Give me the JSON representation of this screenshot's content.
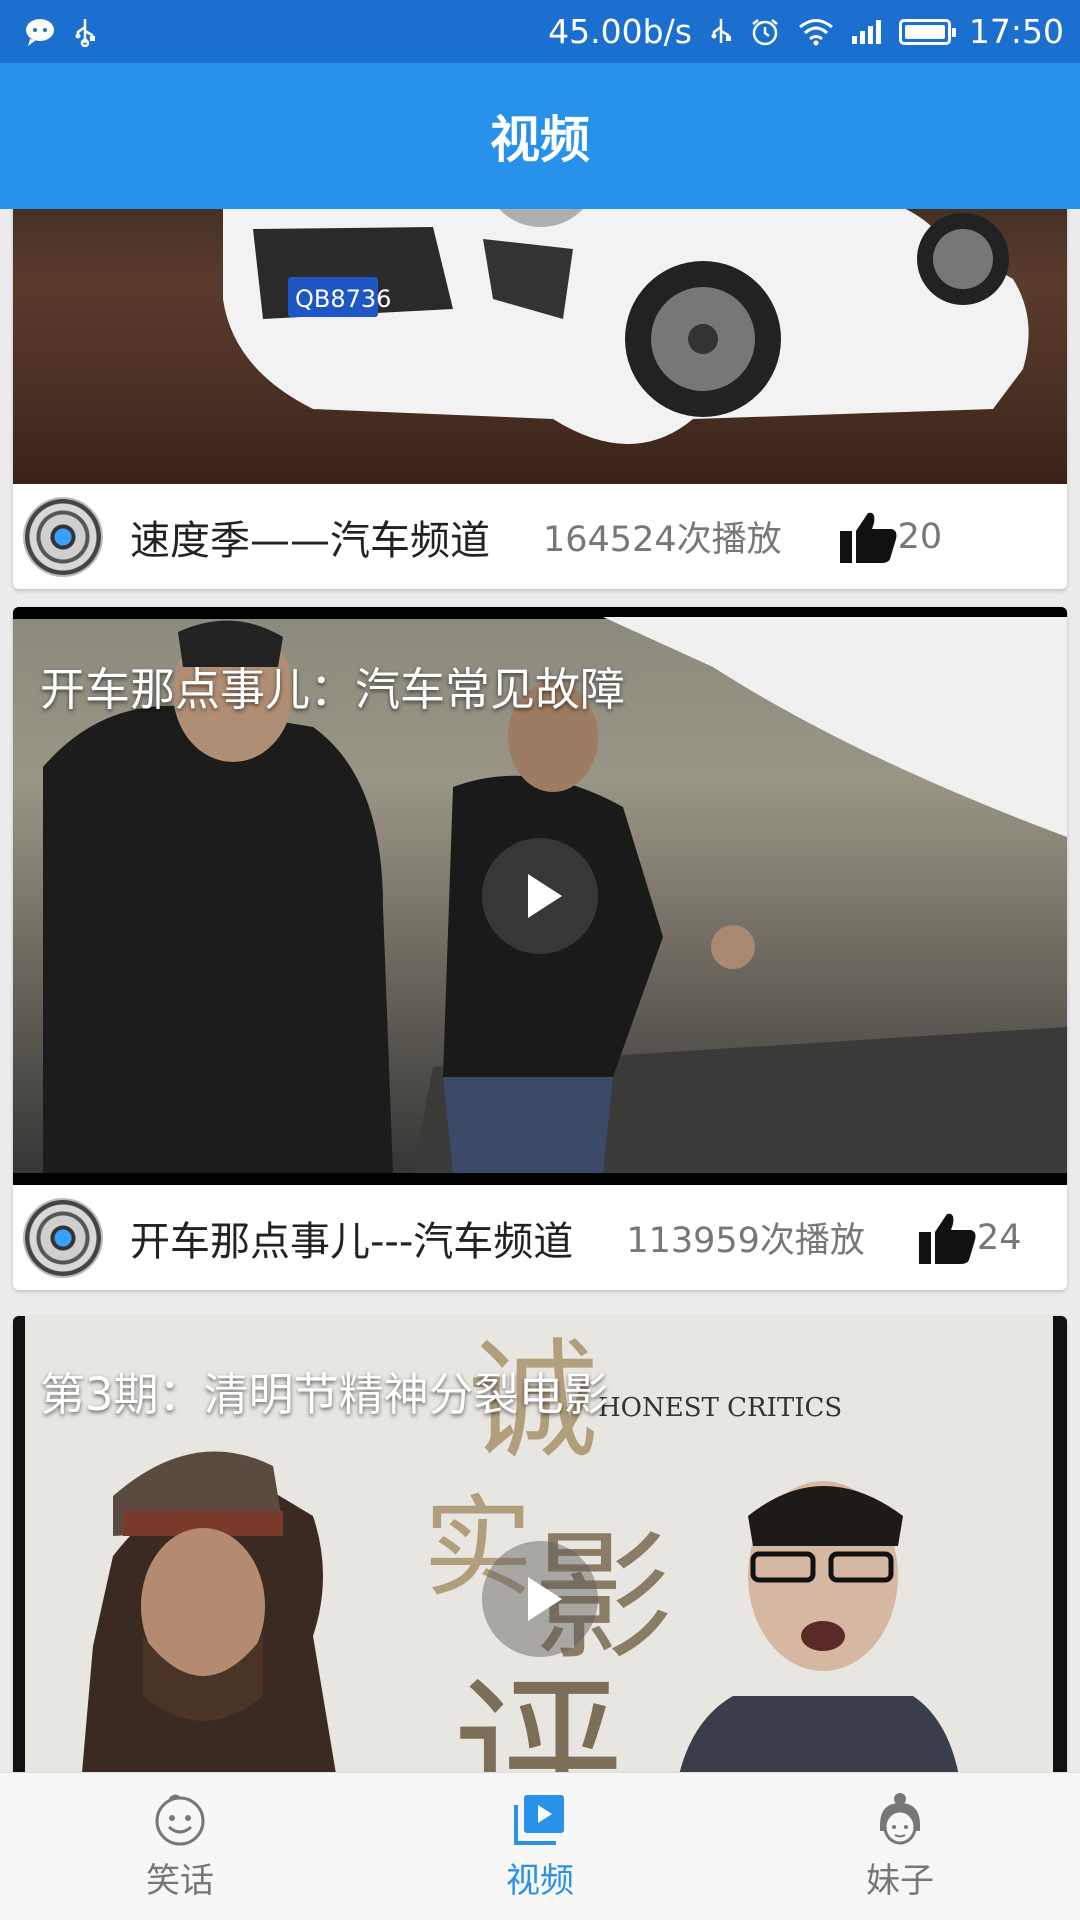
{
  "status_bar": {
    "network_speed": "45.00b/s",
    "time": "17:50",
    "icons": [
      "chat-bubble-icon",
      "usb-icon",
      "usb-icon",
      "alarm-icon",
      "wifi-icon",
      "signal-icon",
      "battery-icon"
    ]
  },
  "header": {
    "title": "视频"
  },
  "feed": {
    "cards": [
      {
        "title": "",
        "channel": "速度季——汽车频道",
        "plays": "164524次播放",
        "likes": "20"
      },
      {
        "title": "开车那点事儿：汽车常见故障",
        "channel": "开车那点事儿---汽车频道",
        "plays": "113959次播放",
        "likes": "24"
      },
      {
        "title": "第3期：清明节精神分裂电影",
        "thumb_text": "HONEST CRITICS",
        "thumb_calligraphy": "诚实影评"
      }
    ]
  },
  "bottom_nav": {
    "items": [
      {
        "label": "笑话",
        "icon": "smiley-face-icon",
        "active": false
      },
      {
        "label": "视频",
        "icon": "video-play-icon",
        "active": true
      },
      {
        "label": "妹子",
        "icon": "girl-face-icon",
        "active": false
      }
    ]
  },
  "colors": {
    "status_bar": "#1b6fcf",
    "header": "#2892ea",
    "active_tab": "#2892ea"
  }
}
